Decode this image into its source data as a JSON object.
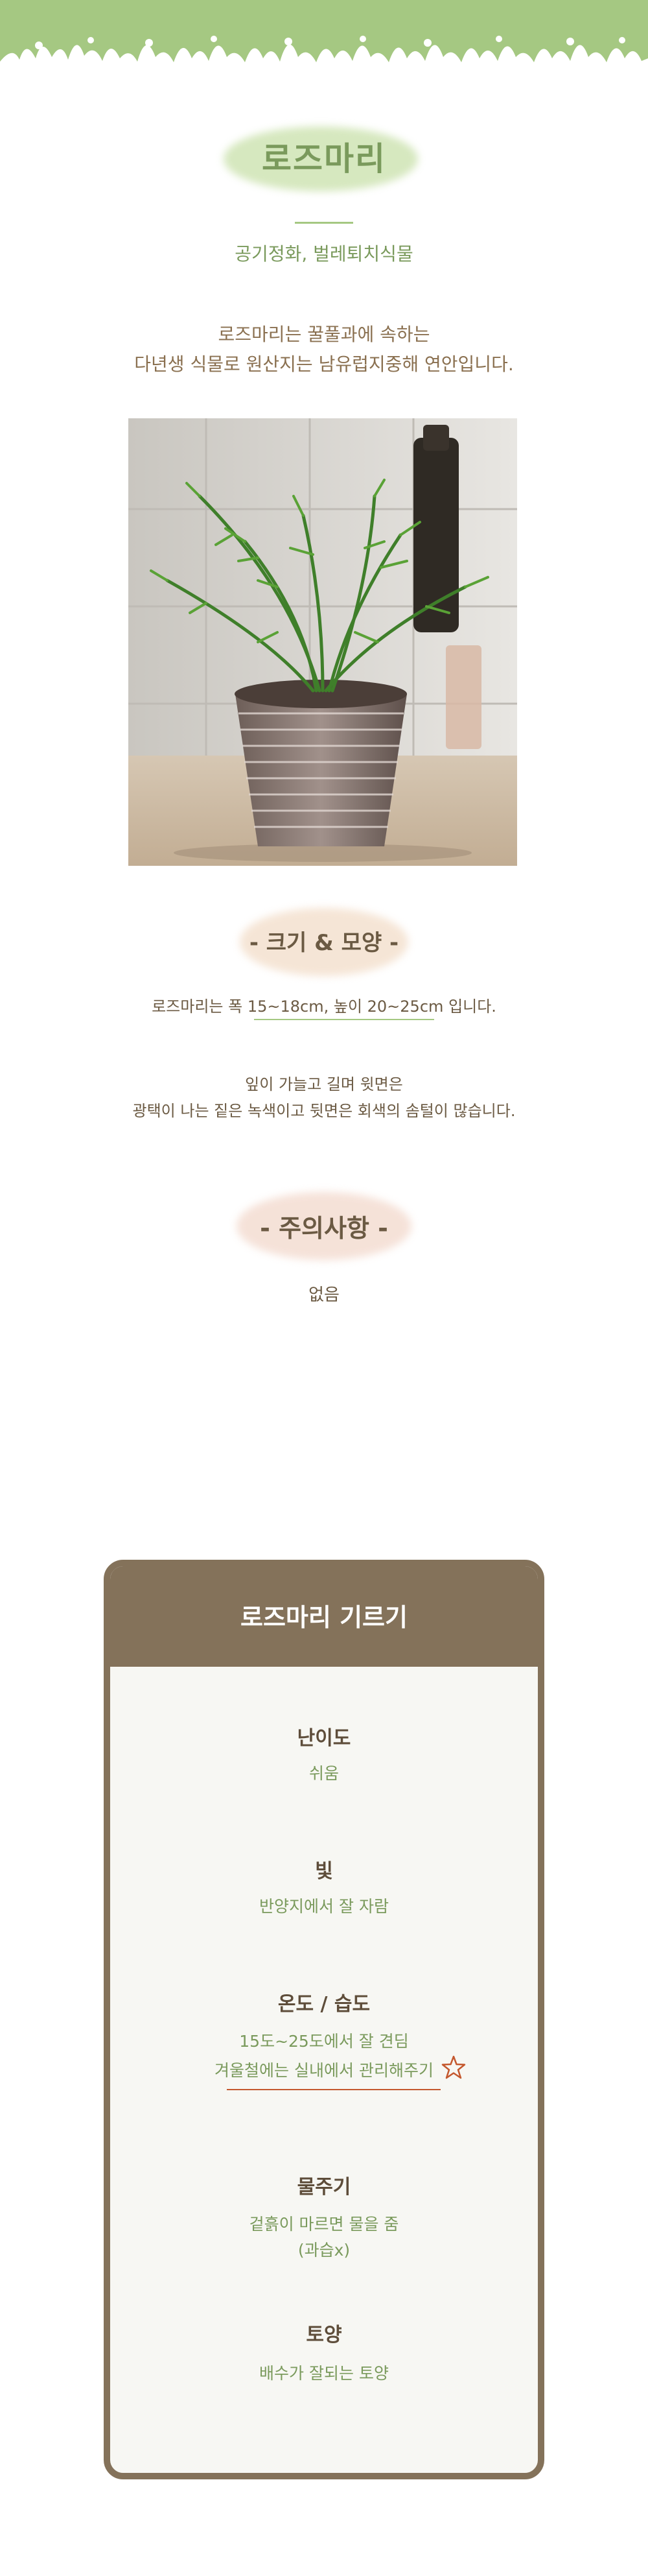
{
  "title": "로즈마리",
  "subtitle": "공기정화, 벌레퇴치식물",
  "intro": [
    "로즈마리는 꿀풀과에 속하는",
    "다년생 식물로 원산지는 남유럽지중해 연안입니다."
  ],
  "photo": {
    "icon": "rosemary-pot-photo"
  },
  "size_section": {
    "heading": "- 크기 & 모양 -",
    "line1": "로즈마리는 폭 15~18cm, 높이 20~25cm 입니다.",
    "line2": "잎이 가늘고 길며 윗면은",
    "line3": "광택이 나는 짙은 녹색이고 뒷면은 회색의 솜털이 많습니다."
  },
  "caution_section": {
    "heading": "- 주의사항 -",
    "text": "없음"
  },
  "care_card": {
    "title": "로즈마리 기르기",
    "items": [
      {
        "label": "난이도",
        "values": [
          "쉬움"
        ]
      },
      {
        "label": "빛",
        "values": [
          "반양지에서 잘 자람"
        ]
      },
      {
        "label": "온도 / 습도",
        "values": [
          "15도~25도에서 잘 견딤",
          "겨울철에는 실내에서 관리해주기"
        ]
      },
      {
        "label": "물주기",
        "values": [
          "겉흙이 마르면 물을 줌",
          "(과습x)"
        ]
      },
      {
        "label": "토양",
        "values": [
          "배수가 잘되는 토양"
        ]
      }
    ]
  },
  "colors": {
    "banner_green": "#a5c882",
    "title_green": "#7a9a5c",
    "card_brown": "#84725a",
    "accent_orange": "#c4582e"
  }
}
